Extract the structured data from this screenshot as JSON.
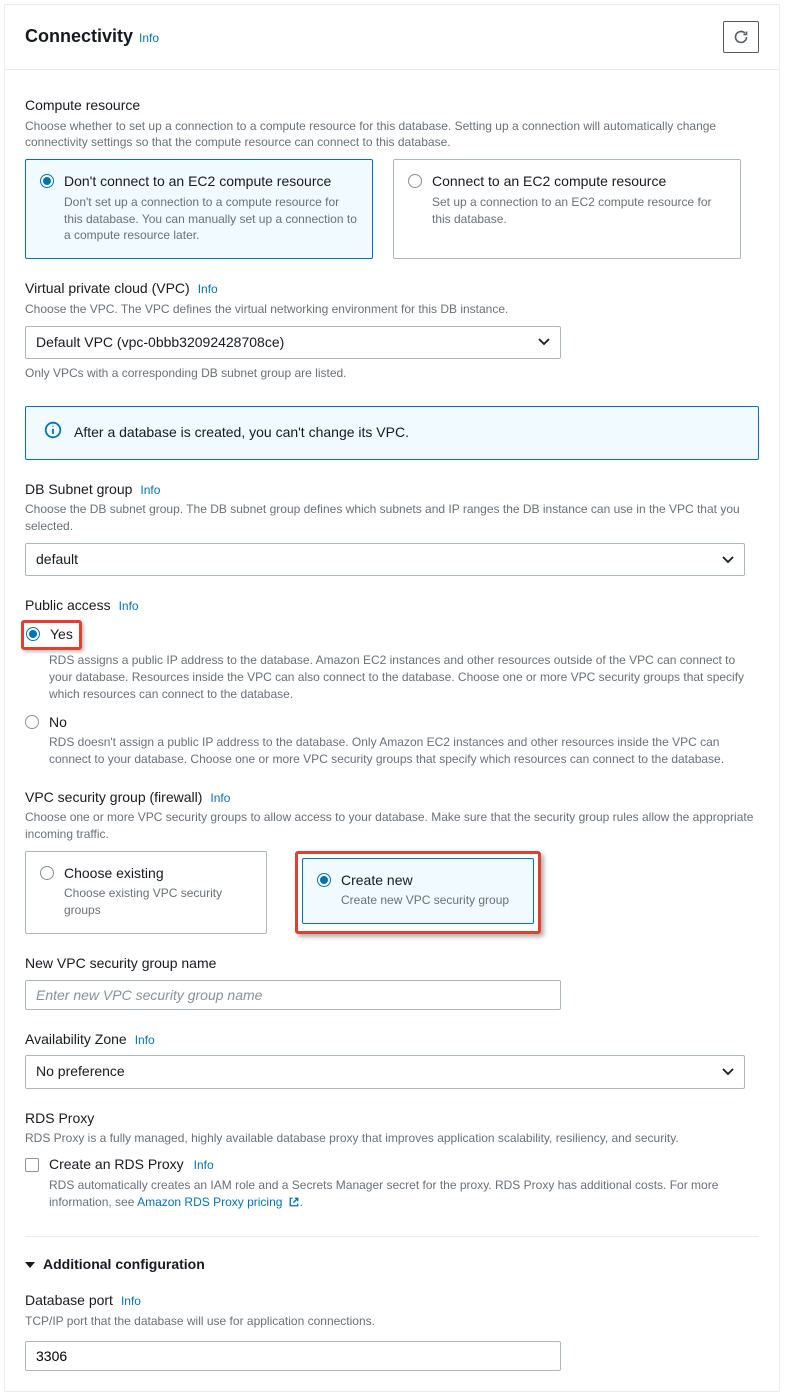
{
  "header": {
    "title": "Connectivity",
    "info": "Info"
  },
  "compute": {
    "label": "Compute resource",
    "desc": "Choose whether to set up a connection to a compute resource for this database. Setting up a connection will automatically change connectivity settings so that the compute resource can connect to this database.",
    "opt_a_title": "Don't connect to an EC2 compute resource",
    "opt_a_desc": "Don't set up a connection to a compute resource for this database. You can manually set up a connection to a compute resource later.",
    "opt_b_title": "Connect to an EC2 compute resource",
    "opt_b_desc": "Set up a connection to an EC2 compute resource for this database."
  },
  "vpc": {
    "label": "Virtual private cloud (VPC)",
    "info": "Info",
    "desc": "Choose the VPC. The VPC defines the virtual networking environment for this DB instance.",
    "value": "Default VPC (vpc-0bbb32092428708ce)",
    "hint": "Only VPCs with a corresponding DB subnet group are listed."
  },
  "alert": {
    "text": "After a database is created, you can't change its VPC."
  },
  "subnet": {
    "label": "DB Subnet group",
    "info": "Info",
    "desc": "Choose the DB subnet group. The DB subnet group defines which subnets and IP ranges the DB instance can use in the VPC that you selected.",
    "value": "default"
  },
  "public": {
    "label": "Public access",
    "info": "Info",
    "yes_label": "Yes",
    "yes_desc": "RDS assigns a public IP address to the database. Amazon EC2 instances and other resources outside of the VPC can connect to your database. Resources inside the VPC can also connect to the database. Choose one or more VPC security groups that specify which resources can connect to the database.",
    "no_label": "No",
    "no_desc": "RDS doesn't assign a public IP address to the database. Only Amazon EC2 instances and other resources inside the VPC can connect to your database. Choose one or more VPC security groups that specify which resources can connect to the database."
  },
  "sg": {
    "label": "VPC security group (firewall)",
    "info": "Info",
    "desc": "Choose one or more VPC security groups to allow access to your database. Make sure that the security group rules allow the appropriate incoming traffic.",
    "existing_title": "Choose existing",
    "existing_desc": "Choose existing VPC security groups",
    "new_title": "Create new",
    "new_desc": "Create new VPC security group"
  },
  "sg_name": {
    "label": "New VPC security group name",
    "placeholder": "Enter new VPC security group name"
  },
  "az": {
    "label": "Availability Zone",
    "info": "Info",
    "value": "No preference"
  },
  "proxy": {
    "label": "RDS Proxy",
    "desc": "RDS Proxy is a fully managed, highly available database proxy that improves application scalability, resiliency, and security.",
    "checkbox_label": "Create an RDS Proxy",
    "info": "Info",
    "sub": "RDS automatically creates an IAM role and a Secrets Manager secret for the proxy. RDS Proxy has additional costs. For more information, see ",
    "link": "Amazon RDS Proxy pricing"
  },
  "additional": {
    "title": "Additional configuration"
  },
  "port": {
    "label": "Database port",
    "info": "Info",
    "desc": "TCP/IP port that the database will use for application connections.",
    "value": "3306"
  }
}
